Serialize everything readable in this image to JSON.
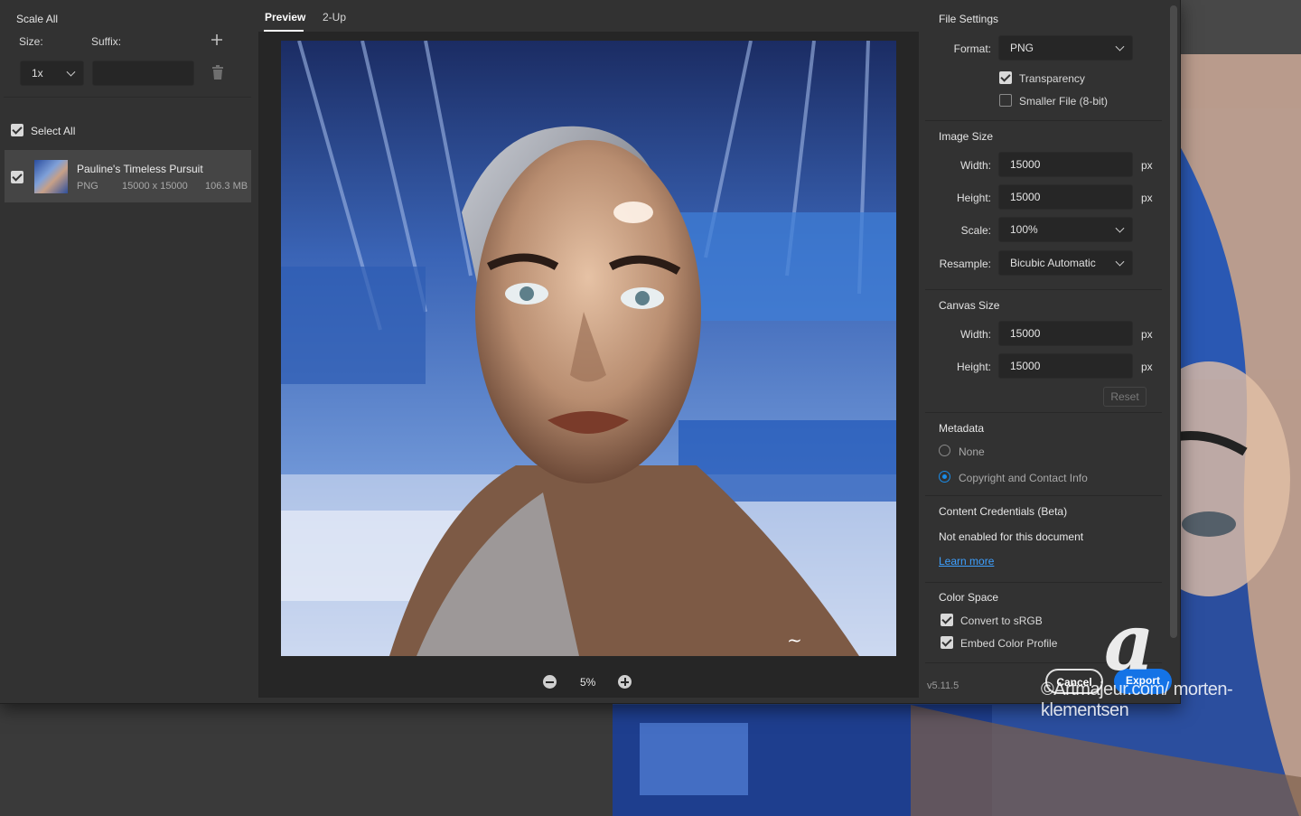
{
  "left_panel": {
    "scale_all": "Scale All",
    "size_label": "Size:",
    "suffix_label": "Suffix:",
    "size_value": "1x",
    "suffix_value": "",
    "select_all": "Select All",
    "file": {
      "name": "Pauline's Timeless Pursuit",
      "format": "PNG",
      "dimensions": "15000 x 15000",
      "filesize": "106.3 MB"
    }
  },
  "preview": {
    "tabs": [
      "Preview",
      "2-Up"
    ],
    "active_tab": "Preview",
    "zoom": "5%"
  },
  "file_settings": {
    "title": "File Settings",
    "format_label": "Format:",
    "format_value": "PNG",
    "transparency": "Transparency",
    "smaller_file": "Smaller File (8-bit)"
  },
  "image_size": {
    "title": "Image Size",
    "width_label": "Width:",
    "width_value": "15000",
    "height_label": "Height:",
    "height_value": "15000",
    "scale_label": "Scale:",
    "scale_value": "100%",
    "resample_label": "Resample:",
    "resample_value": "Bicubic Automatic",
    "unit": "px"
  },
  "canvas_size": {
    "title": "Canvas Size",
    "width_label": "Width:",
    "width_value": "15000",
    "height_label": "Height:",
    "height_value": "15000",
    "unit": "px",
    "reset": "Reset"
  },
  "metadata": {
    "title": "Metadata",
    "option_none": "None",
    "option_copyright": "Copyright and Contact Info"
  },
  "content_credentials": {
    "title": "Content Credentials (Beta)",
    "status": "Not enabled for this document",
    "learn_more": "Learn more"
  },
  "color_space": {
    "title": "Color Space",
    "convert": "Convert to sRGB",
    "embed": "Embed Color Profile"
  },
  "footer": {
    "version": "v5.11.5",
    "cancel": "Cancel",
    "export": "Export"
  },
  "watermark": {
    "text": "©Artmajeur.com/ morten-klementsen"
  },
  "colors": {
    "accent": "#1473e6",
    "link": "#3ea0ff",
    "panel": "#323232",
    "preview_bg": "#262626"
  }
}
